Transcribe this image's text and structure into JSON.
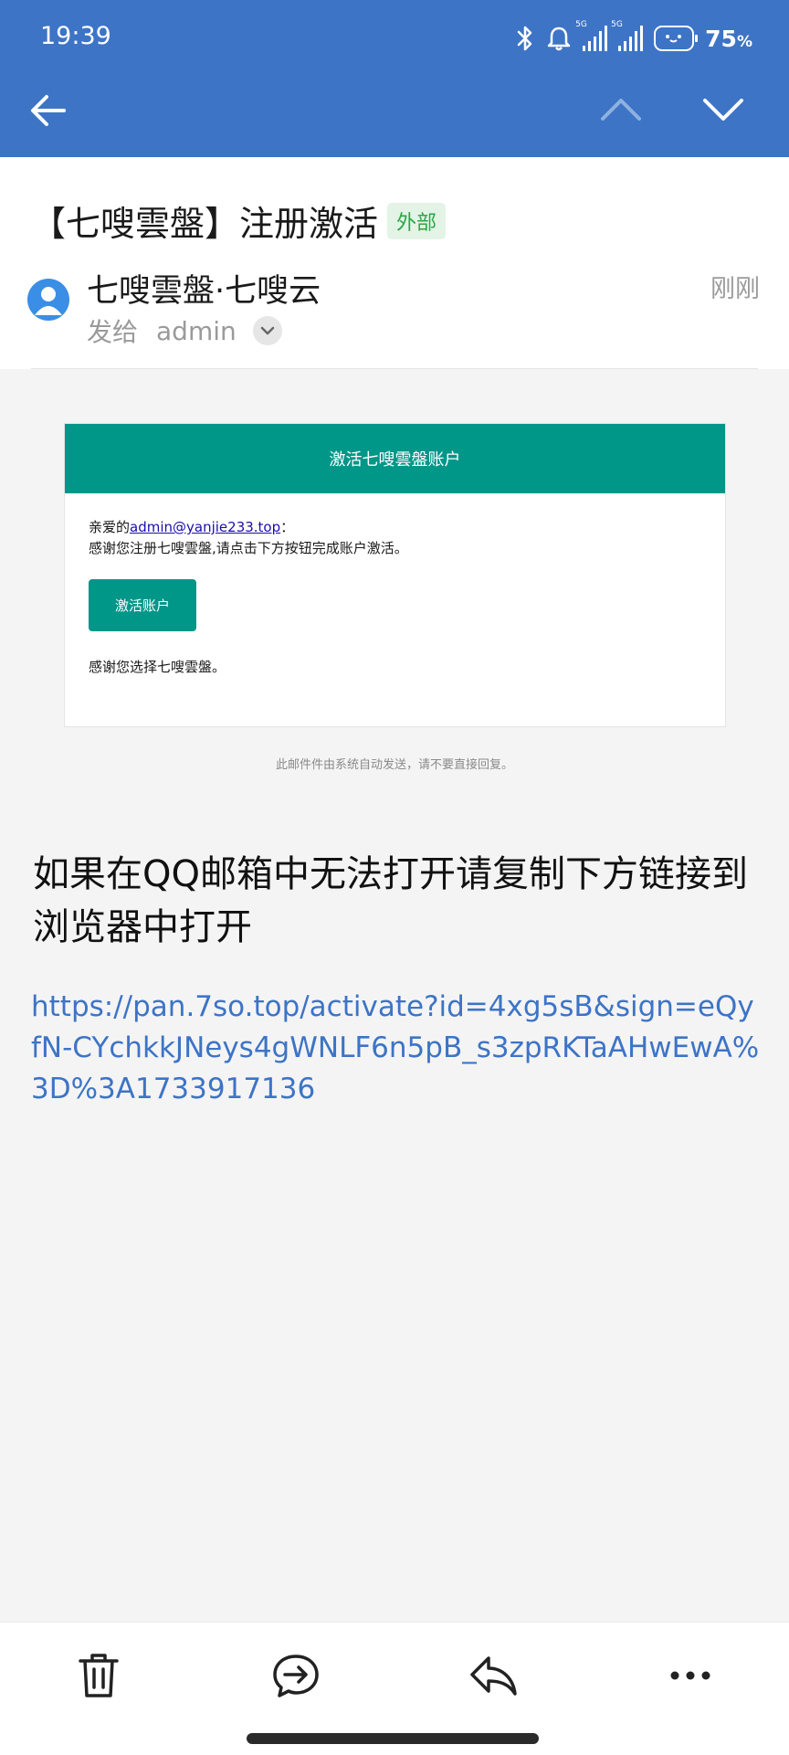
{
  "status_bar": {
    "time": "19:39",
    "battery_percent": "75",
    "battery_unit": "%",
    "network_label": "5G"
  },
  "toolbar": {
    "back_icon": "back-arrow-icon",
    "prev_icon": "chevron-up-icon",
    "next_icon": "chevron-down-icon"
  },
  "email": {
    "subject": "【七嗖雲盤】注册激活",
    "external_badge": "外部",
    "sender": "七嗖雲盤·七嗖云",
    "to_prefix": "发给",
    "to_name": "admin",
    "time": "刚刚"
  },
  "card": {
    "header": "激活七嗖雲盤账户",
    "greeting_prefix": "亲爱的",
    "email_link": "admin@yanjie233.top",
    "greeting_suffix": "：",
    "body_line": "感谢您注册七嗖雲盤,请点击下方按钮完成账户激活。",
    "button": "激活账户",
    "thanks": "感谢您选择七嗖雲盤。"
  },
  "footer_note": "此邮件件由系统自动发送，请不要直接回复。",
  "notice": "如果在QQ邮箱中无法打开请复制下方链接到浏览器中打开",
  "activation_url": "https://pan.7so.top/activate?id=4xg5sB&sign=eQyfN-CYchkkJNeys4gWNLF6n5pB_s3zpRKTaAHwEwA%3D%3A1733917136",
  "bottom_bar": {
    "icons": [
      "trash-icon",
      "forward-icon",
      "reply-icon",
      "more-icon"
    ]
  },
  "colors": {
    "header_blue": "#3d74c6",
    "teal": "#009688",
    "link_blue": "#3d74c6",
    "external_green": "#28a745"
  }
}
